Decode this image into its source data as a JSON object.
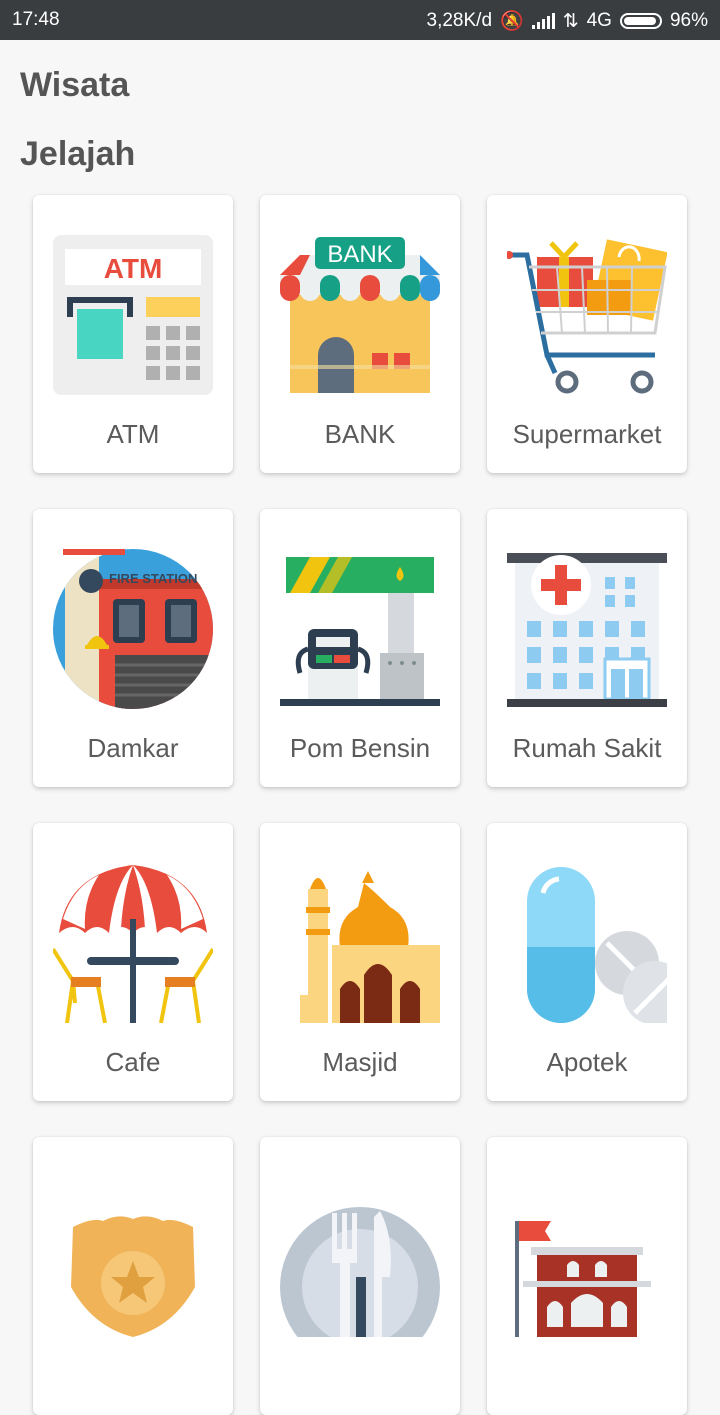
{
  "status_bar": {
    "time": "17:48",
    "net_speed": "3,28K/d",
    "network": "4G",
    "battery": "96%"
  },
  "header": {
    "title": "Wisata"
  },
  "section": {
    "title": "Jelajah"
  },
  "categories": [
    {
      "label": "ATM",
      "icon": "atm-icon"
    },
    {
      "label": "BANK",
      "icon": "bank-icon"
    },
    {
      "label": "Supermarket",
      "icon": "shopping-cart-icon"
    },
    {
      "label": "Damkar",
      "icon": "fire-station-icon"
    },
    {
      "label": "Pom Bensin",
      "icon": "gas-station-icon"
    },
    {
      "label": "Rumah Sakit",
      "icon": "hospital-icon"
    },
    {
      "label": "Cafe",
      "icon": "cafe-umbrella-icon"
    },
    {
      "label": "Masjid",
      "icon": "mosque-icon"
    },
    {
      "label": "Apotek",
      "icon": "pills-icon"
    },
    {
      "label": "",
      "icon": "police-badge-icon"
    },
    {
      "label": "",
      "icon": "restaurant-icon"
    },
    {
      "label": "",
      "icon": "government-building-icon"
    }
  ],
  "icon_texts": {
    "atm": "ATM",
    "bank": "BANK",
    "fire_station": "FIRE STATION"
  }
}
